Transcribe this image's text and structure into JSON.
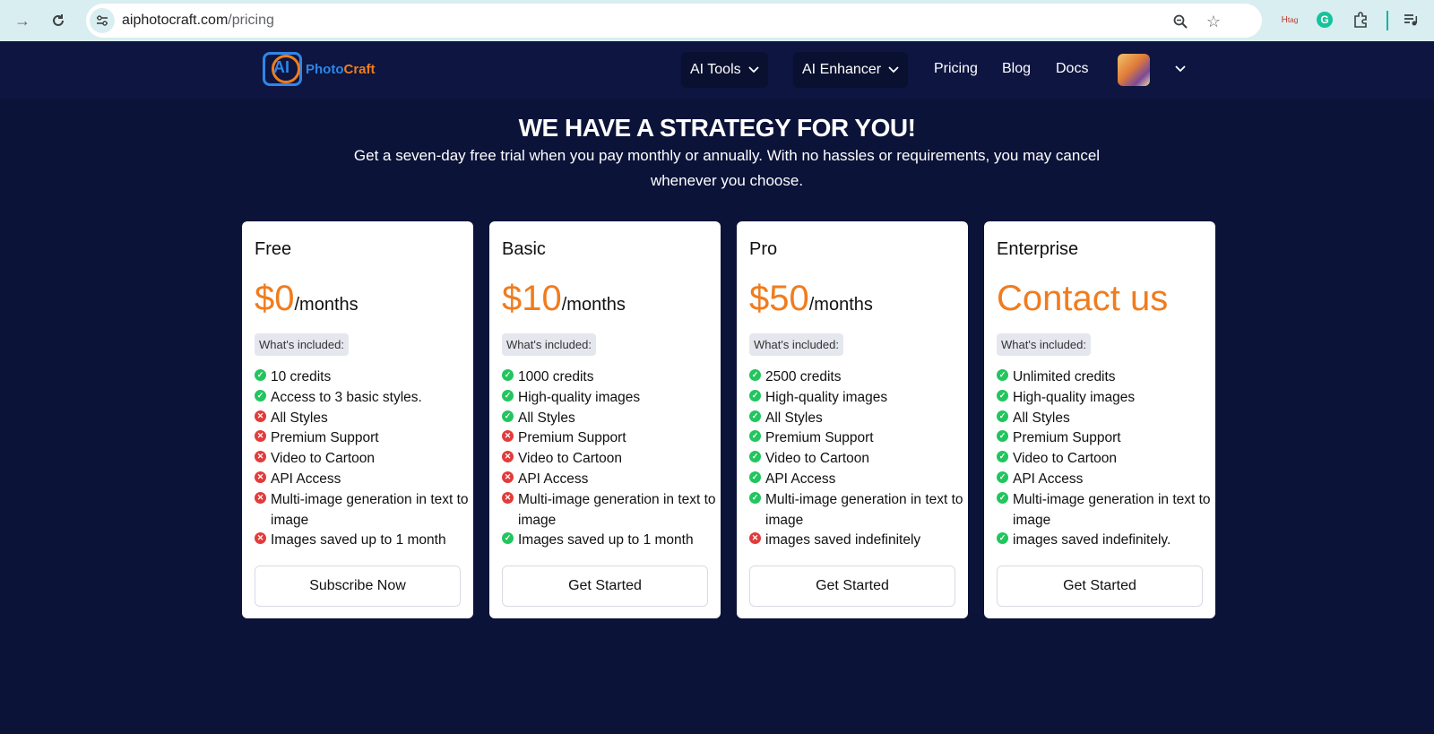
{
  "browser": {
    "url_host": "aiphotocraft.com",
    "url_path": "/pricing"
  },
  "header": {
    "logo_ai": "AI",
    "logo_photo": "Photo",
    "logo_craft": "Craft",
    "menu_ai_tools": "AI Tools",
    "menu_ai_enhancer": "AI Enhancer",
    "link_pricing": "Pricing",
    "link_blog": "Blog",
    "link_docs": "Docs"
  },
  "hero": {
    "title": "WE HAVE A STRATEGY FOR YOU!",
    "subtitle": "Get a seven-day free trial when you pay monthly or annually. With no hassles or requirements, you may cancel whenever you choose."
  },
  "plans": [
    {
      "name": "Free",
      "price": "$0",
      "period": "/months",
      "included_label": "What's included:",
      "features": [
        {
          "text": "10 credits",
          "included": true
        },
        {
          "text": "Access to 3 basic styles.",
          "included": true
        },
        {
          "text": "All Styles",
          "included": false
        },
        {
          "text": "Premium Support",
          "included": false
        },
        {
          "text": "Video to Cartoon",
          "included": false
        },
        {
          "text": "API Access",
          "included": false
        },
        {
          "text": "Multi-image generation in text to image",
          "included": false
        },
        {
          "text": "Images saved up to 1 month",
          "included": false
        }
      ],
      "cta": "Subscribe Now"
    },
    {
      "name": "Basic",
      "price": "$10",
      "period": "/months",
      "included_label": "What's included:",
      "features": [
        {
          "text": "1000 credits",
          "included": true
        },
        {
          "text": "High-quality images",
          "included": true
        },
        {
          "text": "All Styles",
          "included": true
        },
        {
          "text": "Premium Support",
          "included": false
        },
        {
          "text": "Video to Cartoon",
          "included": false
        },
        {
          "text": "API Access",
          "included": false
        },
        {
          "text": "Multi-image generation in text to image",
          "included": false
        },
        {
          "text": "Images saved up to 1 month",
          "included": true
        }
      ],
      "cta": "Get Started"
    },
    {
      "name": "Pro",
      "price": "$50",
      "period": "/months",
      "included_label": "What's included:",
      "features": [
        {
          "text": "2500 credits",
          "included": true
        },
        {
          "text": "High-quality images",
          "included": true
        },
        {
          "text": "All Styles",
          "included": true
        },
        {
          "text": "Premium Support",
          "included": true
        },
        {
          "text": "Video to Cartoon",
          "included": true
        },
        {
          "text": "API Access",
          "included": true
        },
        {
          "text": "Multi-image generation in text to image",
          "included": true
        },
        {
          "text": "images saved indefinitely",
          "included": false
        }
      ],
      "cta": "Get Started"
    },
    {
      "name": "Enterprise",
      "price": "Contact us",
      "period": "",
      "included_label": "What's included:",
      "features": [
        {
          "text": "Unlimited credits",
          "included": true
        },
        {
          "text": "High-quality images",
          "included": true
        },
        {
          "text": "All Styles",
          "included": true
        },
        {
          "text": "Premium Support",
          "included": true
        },
        {
          "text": "Video to Cartoon",
          "included": true
        },
        {
          "text": "API Access",
          "included": true
        },
        {
          "text": "Multi-image generation in text to image",
          "included": true
        },
        {
          "text": "images saved indefinitely.",
          "included": true
        }
      ],
      "cta": "Get Started"
    }
  ],
  "colors": {
    "page_bg": "#0b1339",
    "header_bg": "#0d1540",
    "price_accent": "#f07c1e",
    "check": "#22c55e",
    "cross": "#e23b3b"
  },
  "icons": {
    "included": "check-circle-icon",
    "excluded": "x-circle-icon"
  }
}
